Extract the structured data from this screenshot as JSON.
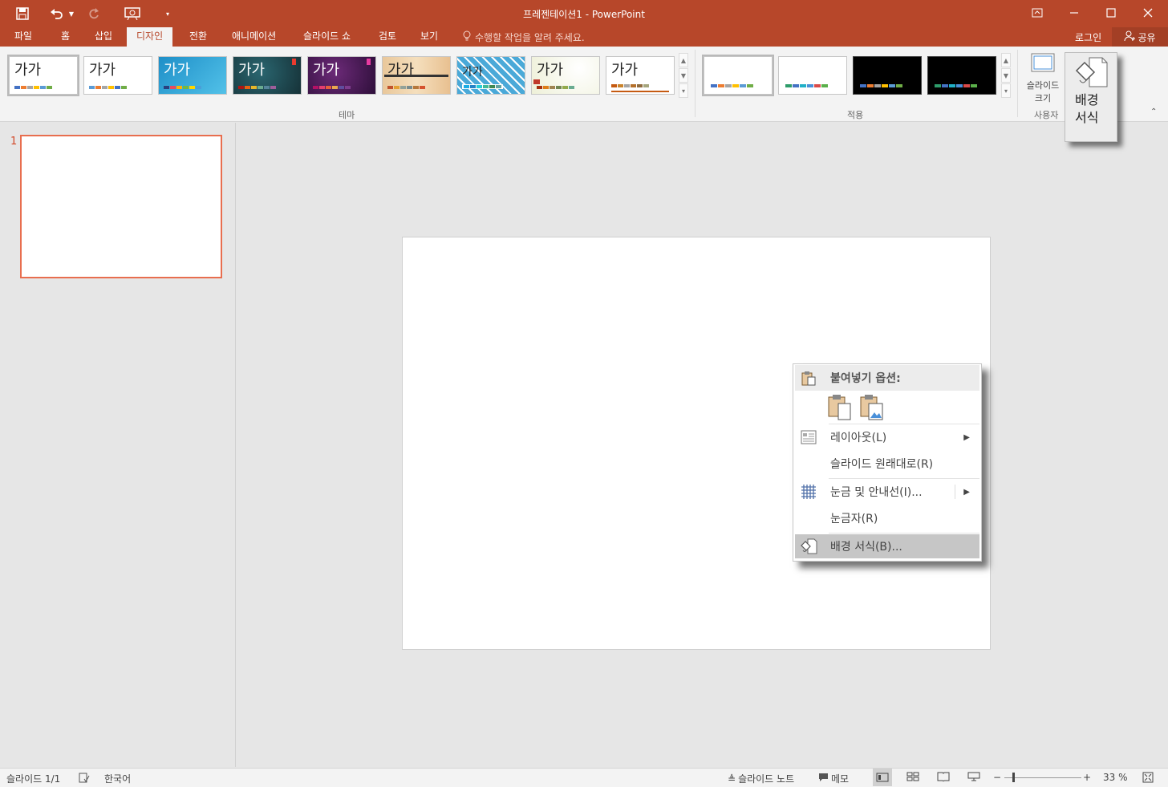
{
  "window": {
    "title": "프레젠테이션1 - PowerPoint",
    "controls": [
      "restore-ribbon",
      "minimize",
      "maximize",
      "close"
    ]
  },
  "ribbon": {
    "tabs": [
      {
        "label": "파일"
      },
      {
        "label": "홈"
      },
      {
        "label": "삽입"
      },
      {
        "label": "디자인",
        "active": true
      },
      {
        "label": "전환"
      },
      {
        "label": "애니메이션"
      },
      {
        "label": "슬라이드 쇼"
      },
      {
        "label": "검토"
      },
      {
        "label": "보기"
      }
    ],
    "tell_me": "수행할 작업을 알려 주세요.",
    "login": "로그인",
    "share": "공유",
    "themes_label": "테마",
    "variants_label": "적용",
    "customize_label": "사용자",
    "theme_sample_text": "가가",
    "slide_size_label": "슬라이드",
    "slide_size_label2": "크기",
    "format_background_line1": "배경",
    "format_background_line2": "서식"
  },
  "slides_panel": {
    "slide_number": "1"
  },
  "context_menu": {
    "paste_options": "붙여넣기 옵션:",
    "items": [
      {
        "label": "레이아웃(L)",
        "submenu": true
      },
      {
        "label": "슬라이드 원래대로(R)",
        "submenu": false
      },
      {
        "label": "눈금 및 안내선(I)...",
        "submenu": true
      },
      {
        "label": "눈금자(R)",
        "submenu": false
      },
      {
        "label": "배경 서식(B)...",
        "submenu": false,
        "highlighted": true
      }
    ]
  },
  "status_bar": {
    "slide_info": "슬라이드 1/1",
    "language": "한국어",
    "notes": "슬라이드 노트",
    "comments": "메모",
    "zoom": "33 %"
  },
  "colors": {
    "accent": "#b7472a",
    "ribbon_bg": "#f3f3f3",
    "workspace": "#e6e6e6",
    "thumb_border": "#e86e4f"
  }
}
